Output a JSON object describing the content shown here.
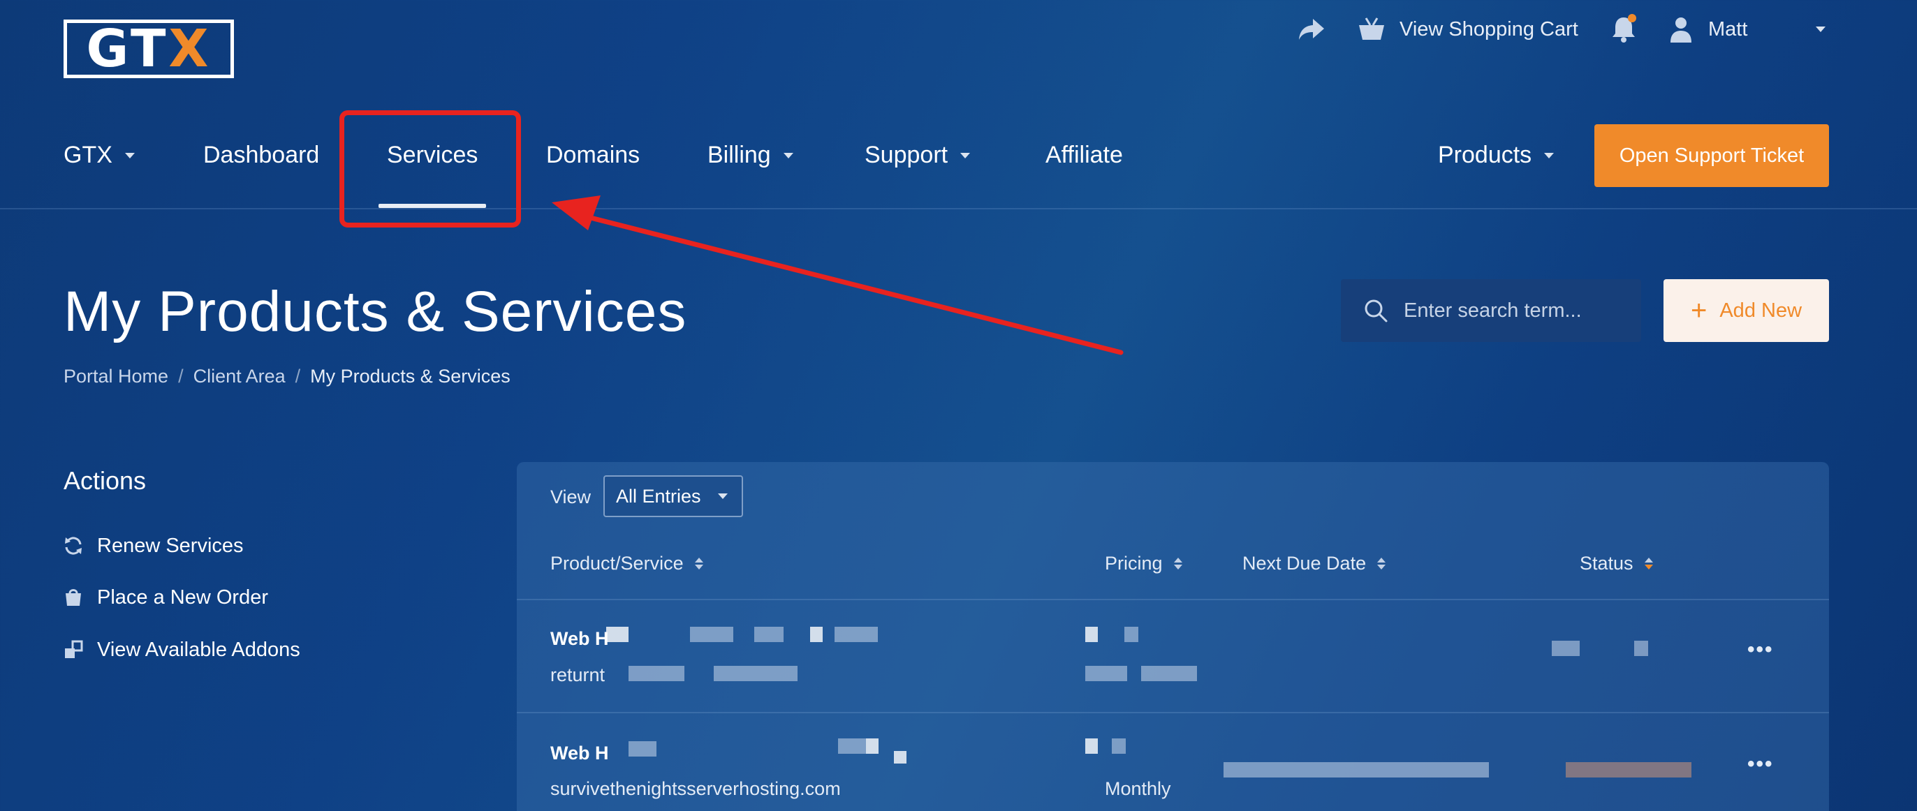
{
  "logo": {
    "text_main": "GT",
    "text_accent": "X"
  },
  "topbar": {
    "cart_label": "View Shopping Cart",
    "user_name": "Matt"
  },
  "nav": {
    "items": [
      {
        "label": "GTX",
        "has_dropdown": true
      },
      {
        "label": "Dashboard",
        "has_dropdown": false
      },
      {
        "label": "Services",
        "has_dropdown": false,
        "active": true
      },
      {
        "label": "Domains",
        "has_dropdown": false
      },
      {
        "label": "Billing",
        "has_dropdown": true
      },
      {
        "label": "Support",
        "has_dropdown": true
      },
      {
        "label": "Affiliate",
        "has_dropdown": false
      }
    ],
    "products_label": "Products",
    "open_ticket_label": "Open Support Ticket"
  },
  "page": {
    "title": "My Products & Services",
    "breadcrumb": [
      "Portal Home",
      "Client Area",
      "My Products & Services"
    ],
    "search_placeholder": "Enter search term...",
    "add_new_label": "Add New"
  },
  "actions": {
    "title": "Actions",
    "items": [
      {
        "label": "Renew Services",
        "icon": "refresh-icon"
      },
      {
        "label": "Place a New Order",
        "icon": "cart-icon"
      },
      {
        "label": "View Available Addons",
        "icon": "addons-icon"
      }
    ]
  },
  "table": {
    "view_label": "View",
    "view_selected": "All Entries",
    "columns": [
      "Product/Service",
      "Pricing",
      "Next Due Date",
      "Status"
    ],
    "rows": [
      {
        "product": "Web H",
        "domain": "returnt",
        "pricing": "",
        "next_due": "",
        "status": ""
      },
      {
        "product": "Web H",
        "domain": "survivethenightsserverhosting.com",
        "pricing": "Monthly",
        "next_due": "",
        "status": ""
      }
    ]
  },
  "colors": {
    "accent": "#f08a2a",
    "annotation": "#e8231f",
    "background": "#0f4186"
  }
}
